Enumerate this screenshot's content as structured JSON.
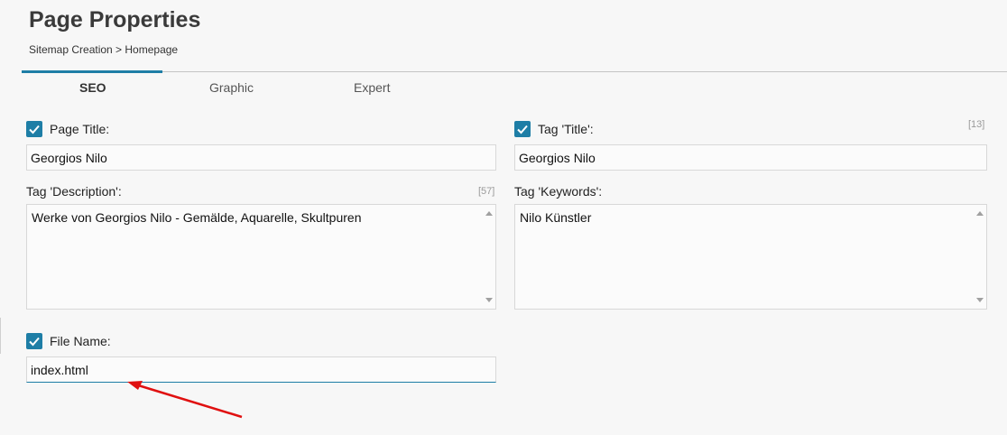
{
  "header": {
    "title": "Page Properties",
    "breadcrumb": "Sitemap Creation > Homepage"
  },
  "tabs": [
    {
      "label": "SEO",
      "active": true
    },
    {
      "label": "Graphic",
      "active": false
    },
    {
      "label": "Expert",
      "active": false
    }
  ],
  "fields": {
    "page_title": {
      "label": "Page Title:",
      "checked": true,
      "value": "Georgios Nilo"
    },
    "tag_title": {
      "label": "Tag 'Title':",
      "checked": true,
      "value": "Georgios Nilo",
      "counter": "[13]"
    },
    "tag_description": {
      "label": "Tag 'Description':",
      "value": "Werke von Georgios Nilo - Gemälde, Aquarelle, Skultpuren",
      "counter": "[57]"
    },
    "tag_keywords": {
      "label": "Tag 'Keywords':",
      "value": "Nilo Künstler"
    },
    "file_name": {
      "label": "File Name:",
      "checked": true,
      "value": "index.html"
    }
  },
  "colors": {
    "accent": "#1e7ea6",
    "annotation_arrow": "#e01010"
  }
}
